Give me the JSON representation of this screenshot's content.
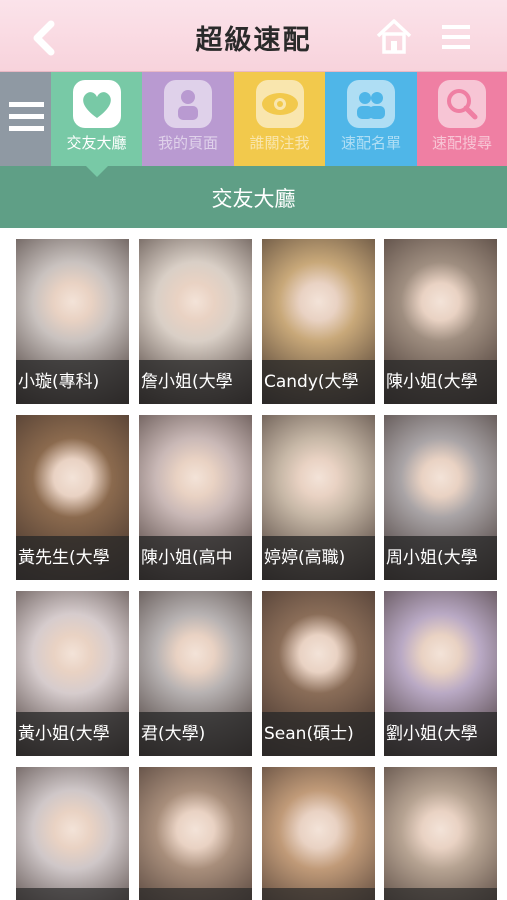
{
  "header": {
    "title": "超級速配",
    "back_icon": "chevron-left-icon",
    "home_icon": "home-icon",
    "menu_icon": "hamburger-menu-icon"
  },
  "tabs": [
    {
      "label": "交友大廳",
      "icon": "heart-icon",
      "color": "#78c9a6",
      "active": true
    },
    {
      "label": "我的頁面",
      "icon": "person-icon",
      "color": "#b99ad1",
      "active": false
    },
    {
      "label": "誰關注我",
      "icon": "eye-icon",
      "color": "#f2c94c",
      "active": false
    },
    {
      "label": "速配名單",
      "icon": "couple-icon",
      "color": "#4fb6e8",
      "active": false
    },
    {
      "label": "速配搜尋",
      "icon": "search-icon",
      "color": "#ef7fa3",
      "active": false
    }
  ],
  "section": {
    "title": "交友大廳"
  },
  "profiles": [
    {
      "name": "小璇(專科)",
      "tone": "#c9c2bf"
    },
    {
      "name": "詹小姐(大學",
      "tone": "#d9cfc6"
    },
    {
      "name": "Candy(大學",
      "tone": "#c8a879"
    },
    {
      "name": "陳小姐(大學",
      "tone": "#9f8e80"
    },
    {
      "name": "黃先生(大學",
      "tone": "#8b6a4e"
    },
    {
      "name": "陳小姐(高中",
      "tone": "#c9b8b6"
    },
    {
      "name": "婷婷(高職)",
      "tone": "#c6b7a6"
    },
    {
      "name": "周小姐(大學",
      "tone": "#a9a4a6"
    },
    {
      "name": "黃小姐(大學",
      "tone": "#d6cccd"
    },
    {
      "name": "君(大學)",
      "tone": "#b7b2b2"
    },
    {
      "name": "Sean(碩士)",
      "tone": "#8a6d58"
    },
    {
      "name": "劉小姐(大學",
      "tone": "#b9a9c4"
    },
    {
      "name": "",
      "tone": "#cfc7c8"
    },
    {
      "name": "",
      "tone": "#a88e7b"
    },
    {
      "name": "",
      "tone": "#c09a78"
    },
    {
      "name": "",
      "tone": "#b6a392"
    }
  ],
  "colors": {
    "header_bg": "#f8d3dc",
    "tabbar_bg": "#9aa3ab",
    "section_bg": "#5f9f86",
    "caption_bg": "#333333"
  }
}
